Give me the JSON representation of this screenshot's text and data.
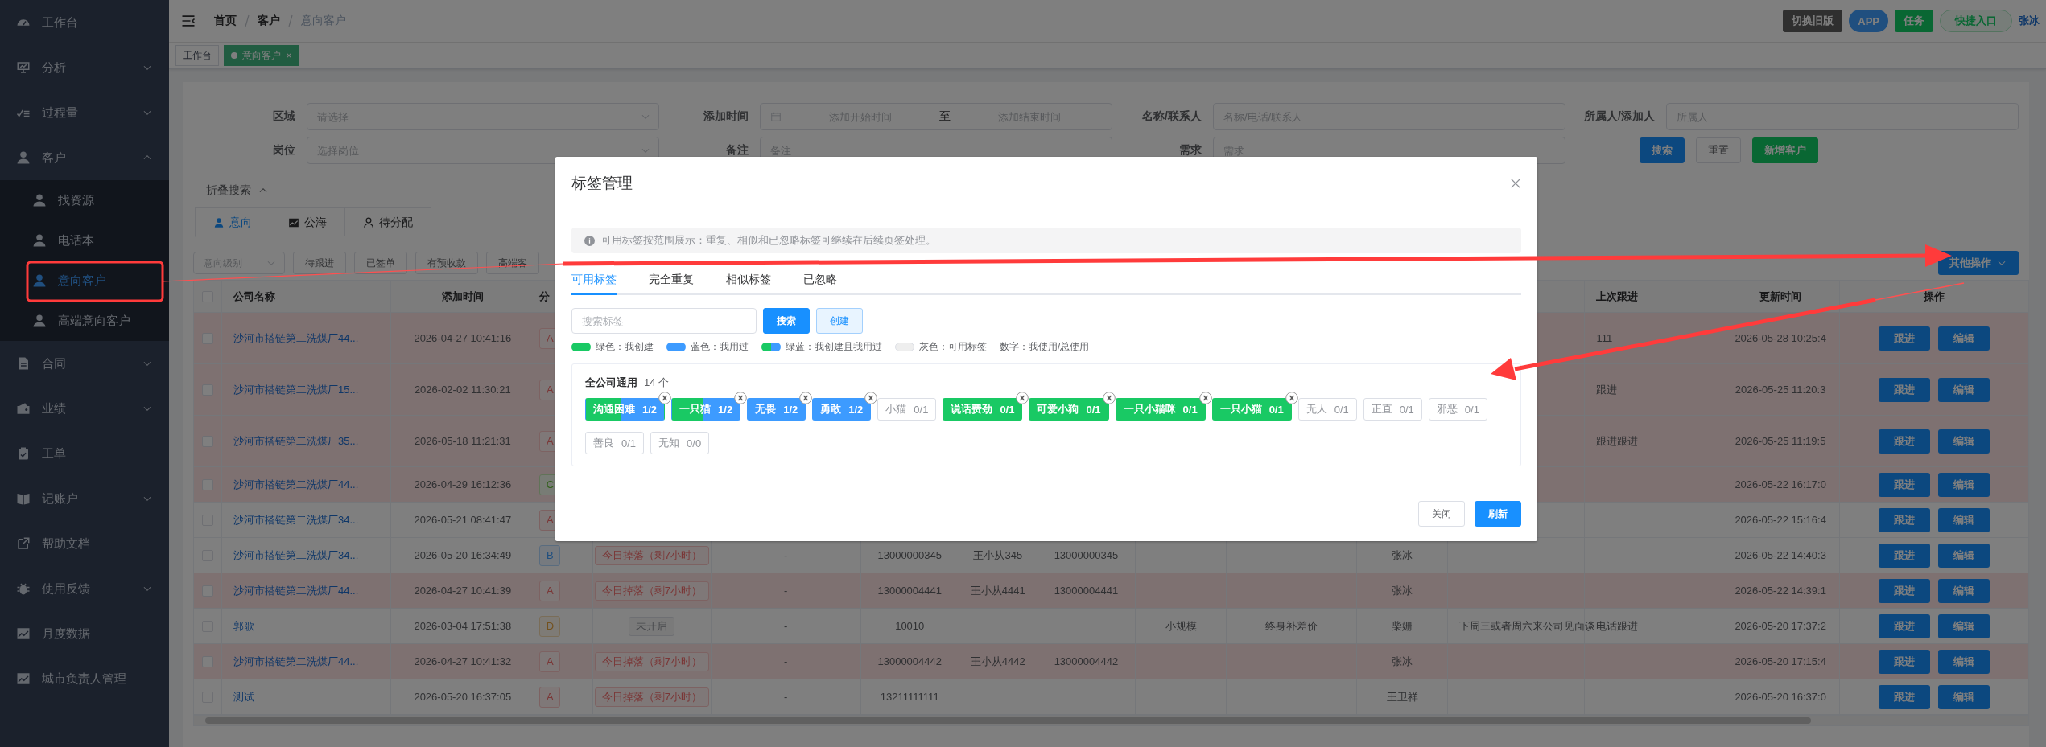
{
  "sidebar": {
    "items": [
      {
        "label": "工作台",
        "kind": "link"
      },
      {
        "label": "分析",
        "kind": "group",
        "expanded": false
      },
      {
        "label": "过程量",
        "kind": "group",
        "expanded": false
      },
      {
        "label": "客户",
        "kind": "group",
        "expanded": true,
        "children": [
          {
            "label": "找资源",
            "selected": false
          },
          {
            "label": "电话本",
            "selected": false
          },
          {
            "label": "意向客户",
            "selected": true
          },
          {
            "label": "高端意向客户",
            "selected": false
          }
        ]
      },
      {
        "label": "合同",
        "kind": "group",
        "expanded": false
      },
      {
        "label": "业绩",
        "kind": "group",
        "expanded": false
      },
      {
        "label": "工单",
        "kind": "link"
      },
      {
        "label": "记账户",
        "kind": "group",
        "expanded": false
      },
      {
        "label": "帮助文档",
        "kind": "link"
      },
      {
        "label": "使用反馈",
        "kind": "group",
        "expanded": false
      },
      {
        "label": "月度数据",
        "kind": "link"
      },
      {
        "label": "城市负责人管理",
        "kind": "link"
      }
    ]
  },
  "header": {
    "breadcrumb": [
      "首页",
      "客户",
      "意向客户"
    ],
    "buttons": [
      {
        "label": "切换旧版",
        "kind": "dark"
      },
      {
        "label": "APP",
        "kind": "pill"
      },
      {
        "label": "任务",
        "kind": "success"
      },
      {
        "label": "快捷入口",
        "kind": "outline"
      }
    ],
    "user": "张冰"
  },
  "tags_view": [
    {
      "label": "工作台",
      "selected": false
    },
    {
      "label": "意向客户",
      "selected": true
    }
  ],
  "filters": {
    "fields": [
      {
        "label": "区域",
        "kind": "select",
        "placeholder": "请选择"
      },
      {
        "label": "添加时间",
        "kind": "daterange",
        "start_placeholder": "添加开始时间",
        "separator": "至",
        "end_placeholder": "添加结束时间"
      },
      {
        "label": "名称/联系人",
        "kind": "text",
        "placeholder": "名称/电话/联系人"
      },
      {
        "label": "所属人/添加人",
        "kind": "text",
        "placeholder": "所属人"
      },
      {
        "label": "岗位",
        "kind": "select",
        "placeholder": "选择岗位"
      },
      {
        "label": "备注",
        "kind": "text",
        "placeholder": "备注"
      },
      {
        "label": "需求",
        "kind": "text",
        "placeholder": "需求"
      }
    ],
    "buttons": [
      {
        "label": "搜索",
        "kind": "primary"
      },
      {
        "label": "重置",
        "kind": "default"
      },
      {
        "label": "新增客户",
        "kind": "success"
      }
    ]
  },
  "fold": {
    "label": "折叠搜索",
    "expanded": true
  },
  "tabs": [
    {
      "label": "意向",
      "selected": true
    },
    {
      "label": "公海",
      "selected": false
    },
    {
      "label": "待分配",
      "selected": false
    }
  ],
  "quick_filters": {
    "select_placeholder": "意向级别",
    "buttons": [
      "待跟进",
      "已签单",
      "有预收款",
      "高端客"
    ]
  },
  "other_actions": "其他操作",
  "table": {
    "select_all_checked": false,
    "columns": [
      "公司名称",
      "添加时间",
      "分",
      null,
      null,
      null,
      null,
      null,
      null,
      null,
      null,
      null,
      "上次跟进",
      "更新时间",
      "操作"
    ],
    "rows": [
      {
        "checked": false,
        "highlighted": true,
        "cells": [
          "沙河市搭链第二洗煤厂44...",
          "2026-04-27 10:41:16",
          {
            "text": "A",
            "kind": "danger"
          },
          null,
          null,
          null,
          null,
          null,
          null,
          null,
          null,
          null,
          "111",
          "2026-05-28 10:25:4"
        ],
        "actions": [
          "跟进",
          "编辑"
        ]
      },
      {
        "checked": false,
        "highlighted": true,
        "cells": [
          "沙河市搭链第二洗煤厂15...",
          "2026-02-02 11:30:21",
          {
            "text": "A",
            "kind": "danger"
          },
          null,
          null,
          null,
          null,
          null,
          null,
          null,
          null,
          null,
          "跟进",
          "2026-05-25 11:20:3"
        ],
        "actions": [
          "跟进",
          "编辑"
        ]
      },
      {
        "checked": false,
        "highlighted": true,
        "cells": [
          "沙河市搭链第二洗煤厂35...",
          "2026-05-18 11:21:31",
          {
            "text": "A",
            "kind": "danger"
          },
          null,
          null,
          null,
          null,
          null,
          null,
          null,
          null,
          null,
          "跟进跟进",
          "2026-05-25 11:19:5"
        ],
        "actions": [
          "跟进",
          "编辑"
        ]
      },
      {
        "checked": false,
        "highlighted": true,
        "cells": [
          "沙河市搭链第二洗煤厂44...",
          "2026-04-29 16:12:36",
          {
            "text": "C",
            "kind": "success"
          },
          null,
          null,
          null,
          null,
          null,
          null,
          null,
          null,
          null,
          null,
          "2026-05-22 16:17:0"
        ],
        "actions": [
          "跟进",
          "编辑"
        ]
      },
      {
        "checked": false,
        "highlighted": false,
        "cells": [
          "沙河市搭链第二洗煤厂34...",
          "2026-05-21 08:41:47",
          {
            "text": "A",
            "kind": "danger"
          },
          null,
          null,
          null,
          null,
          null,
          null,
          null,
          null,
          null,
          null,
          "2026-05-22 15:16:4"
        ],
        "actions": [
          "跟进",
          "编辑"
        ]
      },
      {
        "checked": false,
        "highlighted": false,
        "cells": [
          "沙河市搭链第二洗煤厂34...",
          "2026-05-20 16:34:49",
          {
            "text": "B",
            "kind": "primary"
          },
          {
            "text": "今日掉落（剩7小时）",
            "kind": "warning"
          },
          "-",
          "13000000345",
          "王小从345",
          "13000000345",
          null,
          null,
          "张冰",
          null,
          null,
          "2026-05-22 14:40:3"
        ],
        "actions": [
          "跟进",
          "编辑"
        ]
      },
      {
        "checked": false,
        "highlighted": true,
        "cells": [
          "沙河市搭链第二洗煤厂44...",
          "2026-04-27 10:41:39",
          {
            "text": "A",
            "kind": "danger"
          },
          {
            "text": "今日掉落（剩7小时）",
            "kind": "warning"
          },
          "-",
          "13000004441",
          "王小从4441",
          "13000004441",
          null,
          null,
          "张冰",
          null,
          null,
          "2026-05-22 14:39:1"
        ],
        "actions": [
          "跟进",
          "编辑"
        ]
      },
      {
        "checked": false,
        "highlighted": false,
        "cells": [
          "郭歌",
          "2026-03-04 17:51:38",
          {
            "text": "D",
            "kind": "warning"
          },
          {
            "text": "未开启",
            "kind": "off"
          },
          "-",
          "10010",
          null,
          null,
          "小规模",
          "终身补差价",
          "柴姗",
          "下周三或者周六来公司见面谈",
          "电话跟进",
          "2026-05-20 17:37:2"
        ],
        "actions": [
          "跟进",
          "编辑"
        ]
      },
      {
        "checked": false,
        "highlighted": true,
        "cells": [
          "沙河市搭链第二洗煤厂44...",
          "2026-04-27 10:41:32",
          {
            "text": "A",
            "kind": "danger"
          },
          {
            "text": "今日掉落（剩7小时）",
            "kind": "warning"
          },
          "-",
          "13000004442",
          "王小从4442",
          "13000004442",
          null,
          null,
          "张冰",
          null,
          null,
          "2026-05-20 17:15:4"
        ],
        "actions": [
          "跟进",
          "编辑"
        ]
      },
      {
        "checked": false,
        "highlighted": false,
        "cells": [
          "测试",
          "2026-05-20 16:37:05",
          {
            "text": "A",
            "kind": "danger"
          },
          {
            "text": "今日掉落（剩7小时）",
            "kind": "warning"
          },
          "-",
          "13211111111",
          null,
          null,
          null,
          null,
          "王卫祥",
          null,
          null,
          "2026-05-20 16:37:0"
        ],
        "actions": [
          "跟进",
          "编辑"
        ]
      }
    ]
  },
  "modal": {
    "title": "标签管理",
    "notice": "可用标签按范围展示：重复、相似和已忽略标签可继续在后续页签处理。",
    "tabs": [
      {
        "label": "可用标签",
        "selected": true
      },
      {
        "label": "完全重复",
        "selected": false
      },
      {
        "label": "相似标签",
        "selected": false
      },
      {
        "label": "已忽略",
        "selected": false
      }
    ],
    "search_placeholder": "搜索标签",
    "buttons": [
      {
        "label": "搜索",
        "kind": "primary"
      },
      {
        "label": "创建",
        "kind": "light"
      }
    ],
    "legend": [
      {
        "kind": "green",
        "label": "绿色：我创建"
      },
      {
        "kind": "blue",
        "label": "蓝色：我用过"
      },
      {
        "kind": "mixed",
        "label": "绿蓝：我创建且我用过"
      },
      {
        "kind": "grey",
        "label": "灰色：可用标签"
      },
      {
        "kind": "text",
        "label": "数字：我使用/总使用"
      }
    ],
    "group": {
      "title": "全公司通用",
      "count": "14 个",
      "tags": [
        {
          "name": "沟通困难",
          "count": "1/2",
          "kind": "mixed",
          "closable": true
        },
        {
          "name": "一只猫",
          "count": "1/2",
          "kind": "mixed",
          "closable": true
        },
        {
          "name": "无畏",
          "count": "1/2",
          "kind": "blue",
          "closable": true
        },
        {
          "name": "勇敢",
          "count": "1/2",
          "kind": "blue",
          "closable": true
        },
        {
          "name": "小猫",
          "count": "0/1",
          "kind": "grey",
          "closable": false
        },
        {
          "name": "说话费劲",
          "count": "0/1",
          "kind": "green",
          "closable": true
        },
        {
          "name": "可爱小狗",
          "count": "0/1",
          "kind": "green",
          "closable": true
        },
        {
          "name": "一只小猫咪",
          "count": "0/1",
          "kind": "green",
          "closable": true
        },
        {
          "name": "一只小猫",
          "count": "0/1",
          "kind": "green",
          "closable": true
        },
        {
          "name": "无人",
          "count": "0/1",
          "kind": "grey",
          "closable": false
        },
        {
          "name": "正直",
          "count": "0/1",
          "kind": "grey",
          "closable": false
        },
        {
          "name": "邪恶",
          "count": "0/1",
          "kind": "grey",
          "closable": false
        },
        {
          "name": "善良",
          "count": "0/1",
          "kind": "grey",
          "closable": false
        },
        {
          "name": "无知",
          "count": "0/0",
          "kind": "grey",
          "closable": false
        }
      ]
    },
    "footer": [
      {
        "label": "关闭",
        "kind": "default"
      },
      {
        "label": "刷新",
        "kind": "primary"
      }
    ]
  }
}
